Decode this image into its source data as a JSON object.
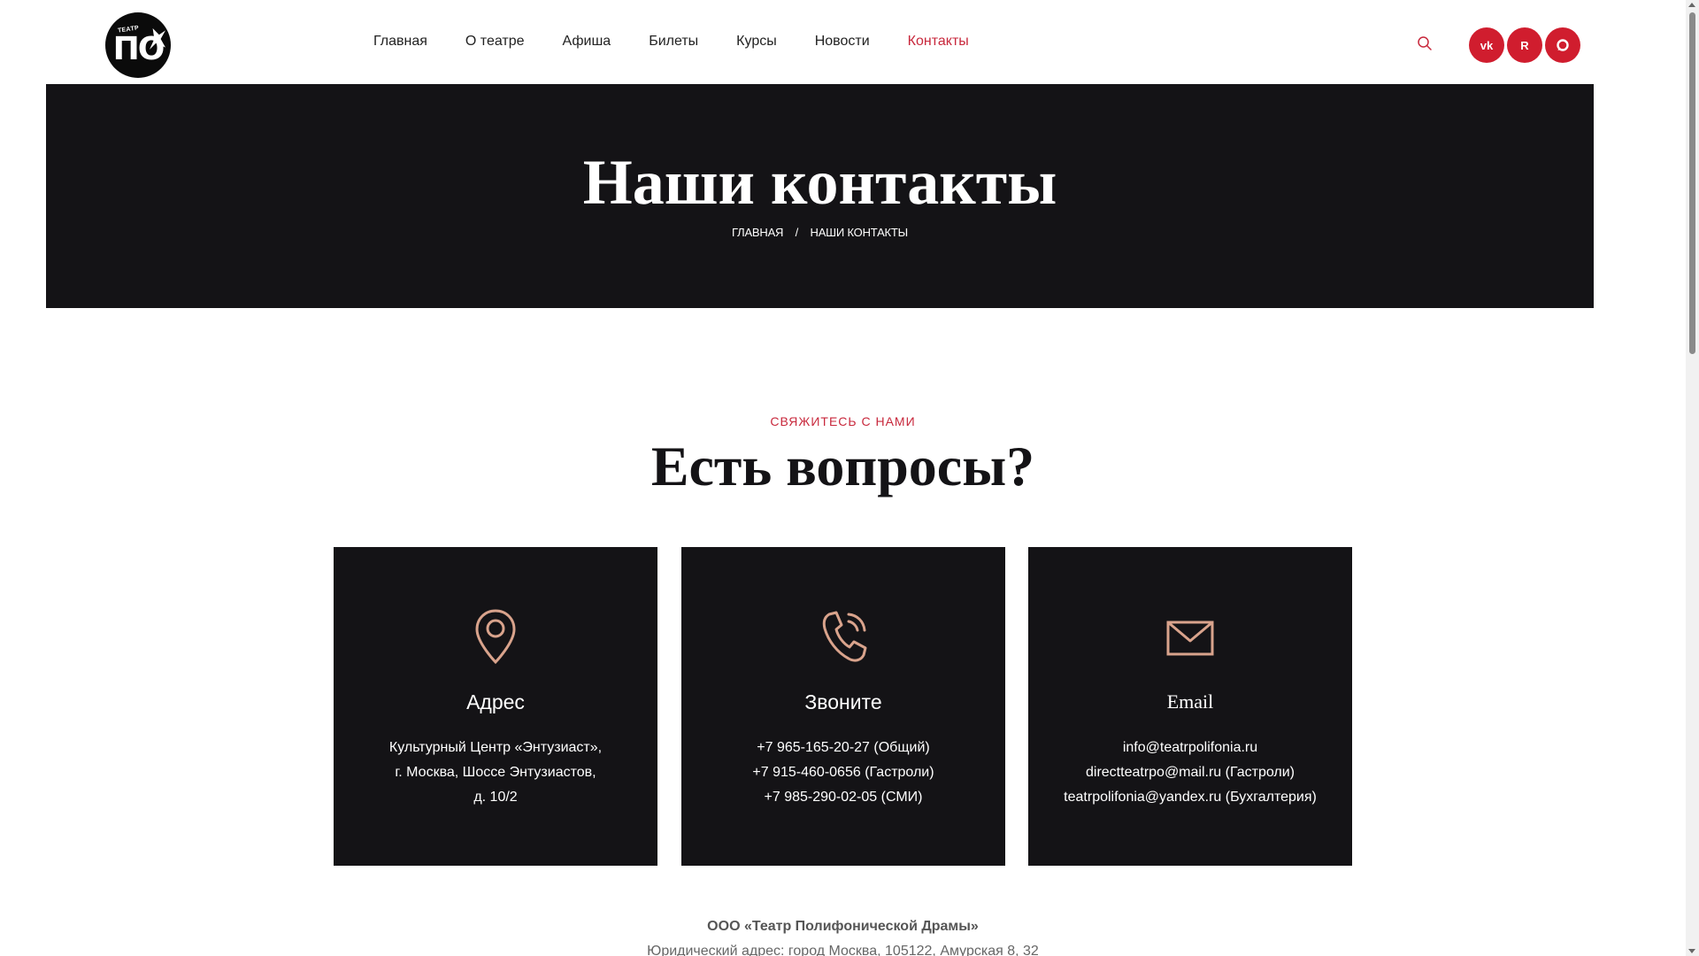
{
  "header": {
    "logo": {
      "small_text": "ТЕАТР",
      "big_text": "ПО"
    },
    "nav": [
      {
        "label": "Главная",
        "active": false
      },
      {
        "label": "О театре",
        "active": false
      },
      {
        "label": "Афиша",
        "active": false
      },
      {
        "label": "Билеты",
        "active": false
      },
      {
        "label": "Курсы",
        "active": false
      },
      {
        "label": "Новости",
        "active": false
      },
      {
        "label": "Контакты",
        "active": true
      }
    ],
    "search_icon": "search-icon",
    "social": [
      {
        "icon": "vk-icon",
        "glyph": "vk"
      },
      {
        "icon": "rutube-icon",
        "glyph": "R"
      },
      {
        "icon": "chat-icon",
        "glyph": "○"
      }
    ]
  },
  "hero": {
    "title": "Наши контакты",
    "breadcrumb": {
      "home": "ГЛАВНАЯ",
      "separator": "/",
      "current": "НАШИ КОНТАКТЫ"
    }
  },
  "section": {
    "eyebrow": "СВЯЖИТЕСЬ С НАМИ",
    "title": "Есть вопросы?"
  },
  "cards": [
    {
      "icon": "map-pin-icon",
      "title": "Адрес",
      "lines": [
        "Культурный Центр «Энтузиаст»,",
        "г. Москва, Шоссе Энтузиастов,",
        "д. 10/2"
      ]
    },
    {
      "icon": "phone-icon",
      "title": "Звоните",
      "lines": [
        "+7 965-165-20-27 (Общий)",
        "+7 915-460-0656 (Гастроли)",
        "+7 985-290-02-05 (СМИ)"
      ]
    },
    {
      "icon": "mail-icon",
      "title": "Email",
      "lines": [
        "info@teatrpolifonia.ru",
        "directteatrpo@mail.ru (Гастроли)",
        "teatrpolifonia@yandex.ru (Бухгалтерия)"
      ]
    }
  ],
  "footer": {
    "org_name": "ООО «Театр Полифонической Драмы»",
    "org_address": "Юридический адрес: город Москва, 105122, Амурская 8, 32"
  },
  "colors": {
    "accent": "#c8283c",
    "social_bg": "#d01d2e",
    "dark": "#141316",
    "icon_stroke": "#d9a38c"
  }
}
